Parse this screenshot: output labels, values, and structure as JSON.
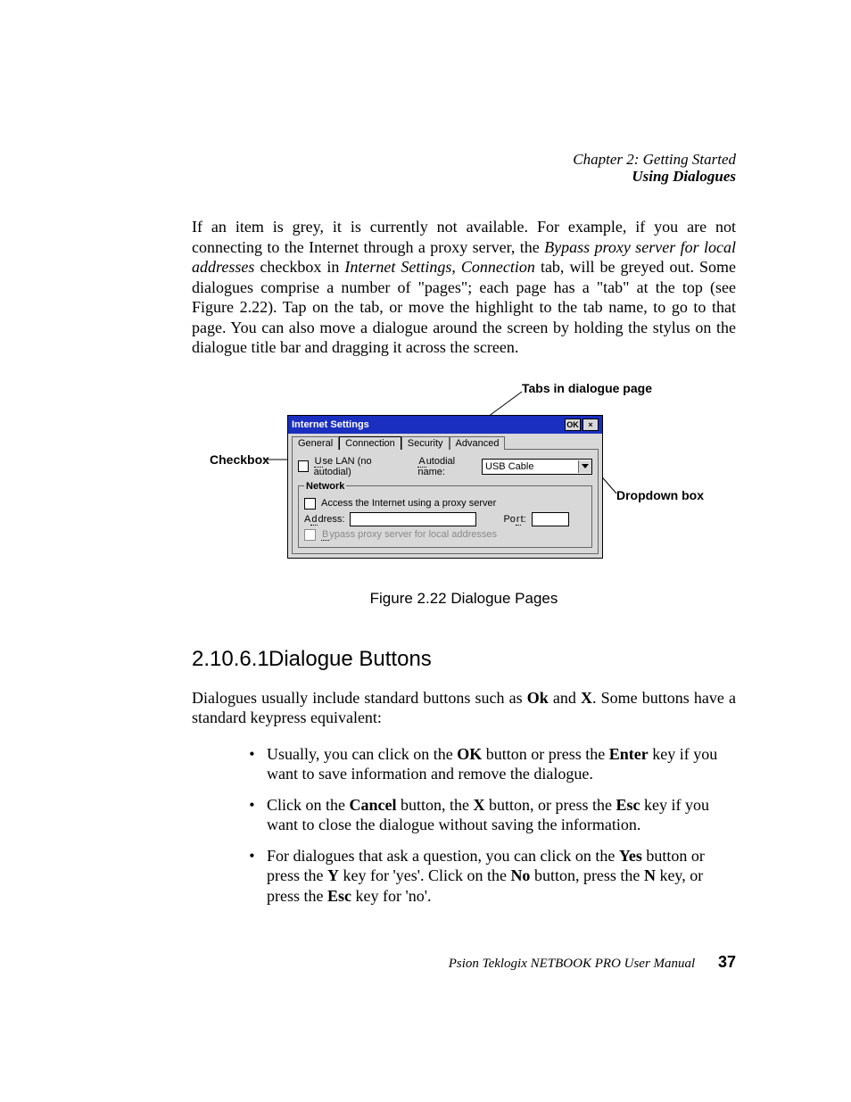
{
  "header": {
    "chapter": "Chapter 2:  Getting Started",
    "section": "Using Dialogues"
  },
  "para1": {
    "a": "If an item is grey, it is currently not available. For example, if you are not connecting to the Internet through a proxy server, the ",
    "i1": "Bypass proxy server for local addresses",
    "b": " checkbox in ",
    "i2": "Internet Settings",
    "c": ", ",
    "i3": "Connection",
    "d": " tab, will be greyed out. Some dialogues comprise a number of \"pages\"; each page has a \"tab\" at the top (see Figure 2.22). Tap on the tab, or move the highlight to the tab name, to go to that page. You can also move a dialogue around the screen by holding the stylus on the dialogue title bar and dragging it across the screen."
  },
  "callouts": {
    "tabs": "Tabs in dialogue page",
    "checkbox": "Checkbox",
    "dropdown": "Dropdown box"
  },
  "dialog": {
    "title": "Internet Settings",
    "ok": "OK",
    "close": "×",
    "tabs": [
      "General",
      "Connection",
      "Security",
      "Advanced"
    ],
    "active_tab_index": 1,
    "uselan_pre": "U",
    "uselan_rest": "se LAN (no autodial)",
    "autodial_label_pre": "A",
    "autodial_label_rest": "utodial name:",
    "autodial_value": "USB Cable",
    "network_legend": "Network",
    "proxy_label": "Access the Internet using a proxy server",
    "address_pre": "A",
    "address_mid": "d",
    "address_rest": "dress:",
    "port_pre": "Po",
    "port_mid": "r",
    "port_rest": "t:",
    "bypass_pre": "B",
    "bypass_rest": "ypass proxy server for local addresses"
  },
  "caption": "Figure 2.22 Dialogue Pages",
  "heading": {
    "num": "2.10.6.1",
    "title": "Dialogue Buttons"
  },
  "para2": {
    "a": "Dialogues usually include standard buttons such as ",
    "b1": "Ok",
    "b": " and ",
    "b2": "X",
    "c": ". Some buttons have a standard keypress equivalent:"
  },
  "bullets": [
    {
      "a": "Usually, you can click on the ",
      "b1": "OK",
      "b": " button or press the ",
      "b2": "Enter",
      "c": " key if you want to save information and remove the dialogue."
    },
    {
      "a": "Click on the ",
      "b1": "Cancel",
      "b": " button, the ",
      "b2": "X",
      "c": " button, or press the ",
      "b3": "Esc",
      "d": " key if you want to close the dialogue without saving the information."
    },
    {
      "a": "For dialogues that ask a question, you can click on the ",
      "b1": "Yes",
      "b": " button or press the ",
      "b2": "Y",
      "c": " key for 'yes'. Click on the ",
      "b3": "No",
      "d": " button, press the ",
      "b4": "N",
      "e": " key, or press the ",
      "b5": "Esc",
      "f": " key for 'no'."
    }
  ],
  "footer": {
    "text": "Psion Teklogix NETBOOK PRO User Manual",
    "page": "37"
  }
}
